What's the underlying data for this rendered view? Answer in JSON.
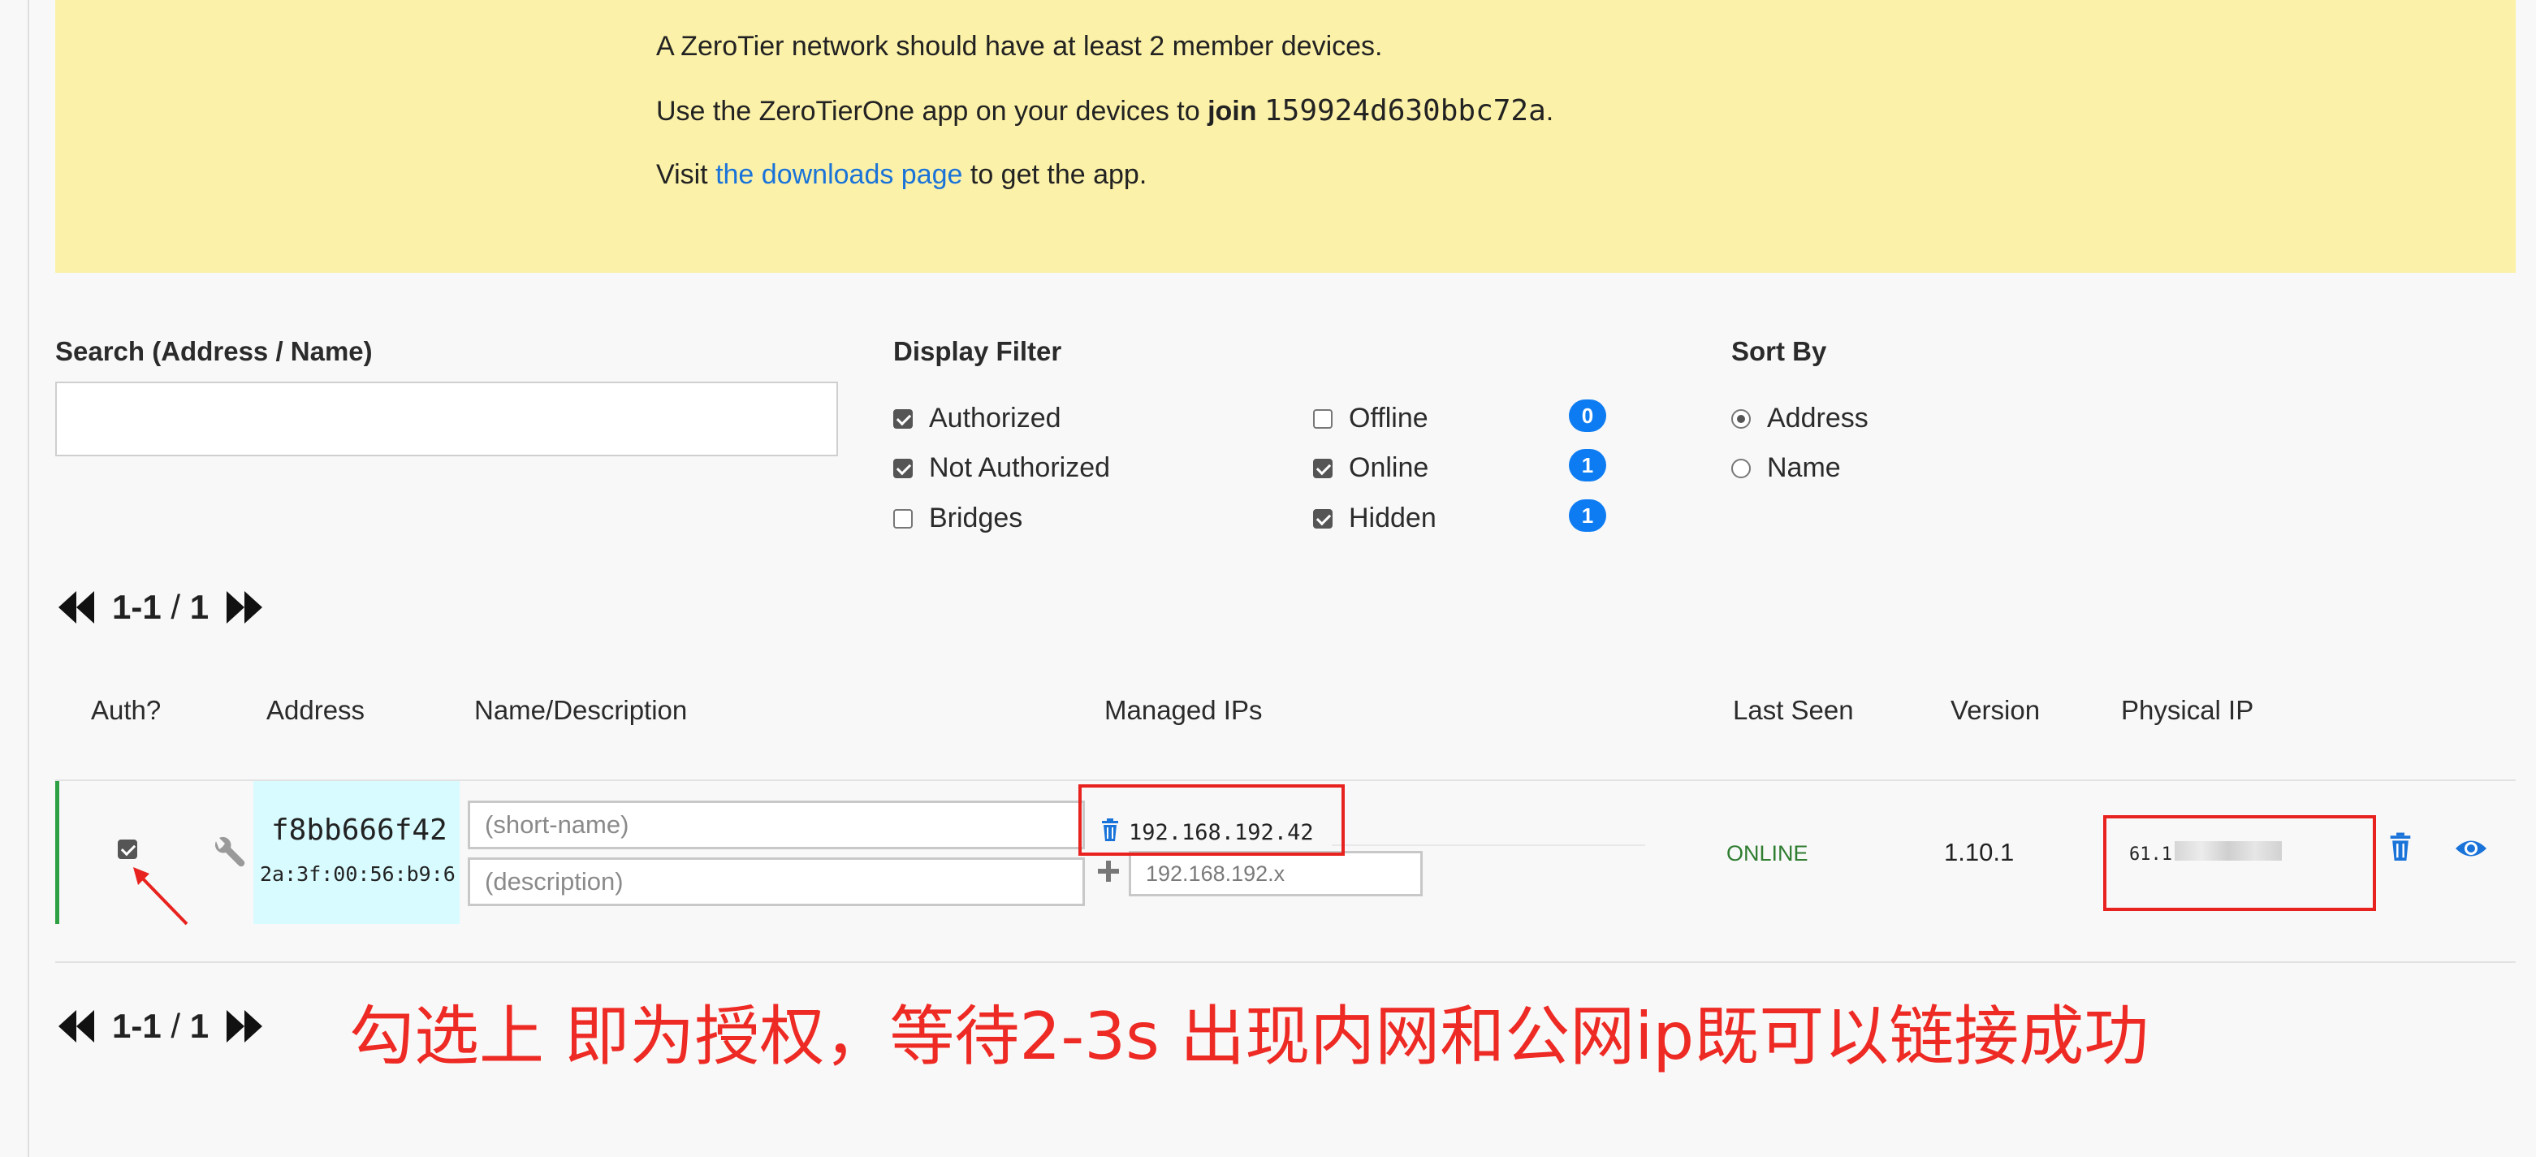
{
  "notice": {
    "line1": "A ZeroTier network should have at least 2 member devices.",
    "line2_prefix": "Use the ZeroTierOne app on your devices to ",
    "line2_join": "join",
    "line2_network_id": "159924d630bbc72a",
    "line2_suffix": ".",
    "line3_prefix": "Visit ",
    "line3_link": "the downloads page",
    "line3_suffix": " to get the app."
  },
  "search": {
    "label": "Search (Address / Name)",
    "value": ""
  },
  "display_filter": {
    "label": "Display Filter",
    "authorized": "Authorized",
    "not_authorized": "Not Authorized",
    "bridges": "Bridges",
    "offline": "Offline",
    "online": "Online",
    "hidden": "Hidden",
    "offline_count": "0",
    "online_count": "1",
    "hidden_count": "1"
  },
  "sort_by": {
    "label": "Sort By",
    "address": "Address",
    "name": "Name"
  },
  "pager": {
    "range": "1-1",
    "sep": " / ",
    "total": "1"
  },
  "table": {
    "headers": {
      "auth": "Auth?",
      "address": "Address",
      "name": "Name/Description",
      "managed_ips": "Managed IPs",
      "last_seen": "Last Seen",
      "version": "Version",
      "physical_ip": "Physical IP"
    },
    "row": {
      "address": "f8bb666f42",
      "address_mac": "2a:3f:00:56:b9:6",
      "name_placeholder": "(short-name)",
      "description_placeholder": "(description)",
      "managed_ip": "192.168.192.42",
      "new_ip_placeholder": "192.168.192.x",
      "last_seen": "ONLINE",
      "version": "1.10.1",
      "physical_ip": "61.1"
    }
  },
  "annotation": "勾选上 即为授权，等待2-3s 出现内网和公网ip既可以链接成功",
  "colors": {
    "notice_bg": "#fbf1a8",
    "link": "#1a73d9",
    "badge": "#0d7cf2",
    "online": "#2f7d31",
    "row_accent": "#2ea043",
    "address_bg": "#d8fbff",
    "annotation_red": "#ee2a24"
  }
}
